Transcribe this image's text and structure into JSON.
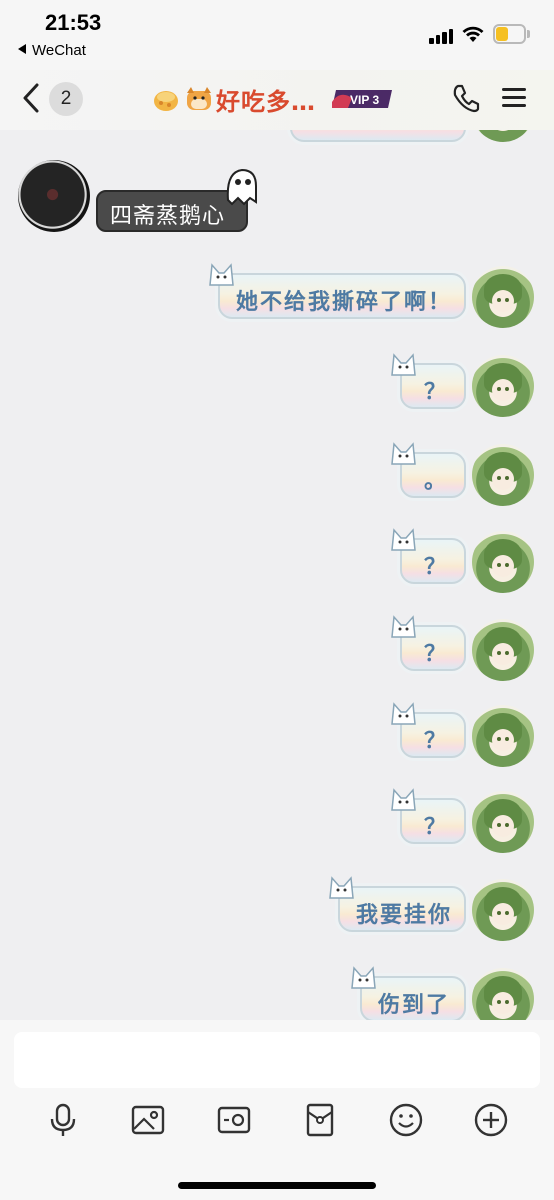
{
  "status_bar": {
    "time": "21:53",
    "back_app": "WeChat"
  },
  "nav": {
    "unread_count": "2",
    "title": "好吃多…",
    "vip_label": "VIP 3",
    "title_color": "#d94a2e"
  },
  "chat": {
    "incoming": [
      {
        "text": "四斋蒸鹅心"
      }
    ],
    "outgoing": [
      {
        "text": "她不给我撕碎了啊！"
      },
      {
        "text": "？"
      },
      {
        "text": "。"
      },
      {
        "text": "？"
      },
      {
        "text": "？"
      },
      {
        "text": "？"
      },
      {
        "text": "？"
      },
      {
        "text": "我要挂你"
      },
      {
        "text": "伤到了"
      }
    ]
  },
  "input": {
    "placeholder": ""
  },
  "toolbar": {
    "icons": [
      "microphone-icon",
      "image-icon",
      "camera-icon",
      "red-packet-icon",
      "emoji-icon",
      "plus-icon"
    ]
  }
}
